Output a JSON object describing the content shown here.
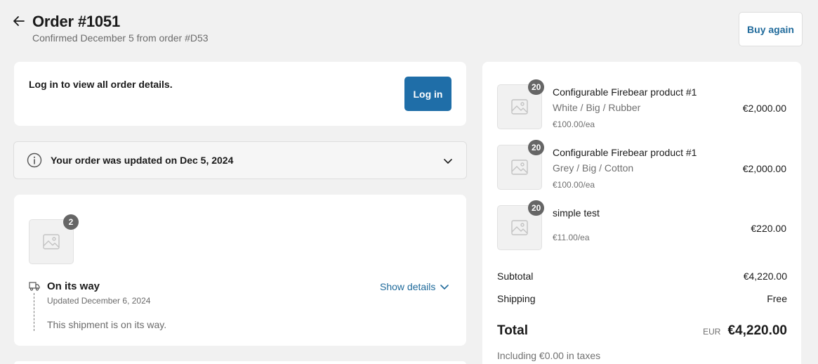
{
  "header": {
    "title": "Order #1051",
    "subtitle": "Confirmed December 5 from order #D53",
    "buy_again_label": "Buy again"
  },
  "login": {
    "text": "Log in to view all order details.",
    "button_label": "Log in"
  },
  "update_notice": {
    "text": "Your order was updated on Dec 5, 2024"
  },
  "shipment": {
    "item_count": "2",
    "status": "On its way",
    "updated": "Updated December 6, 2024",
    "description": "This shipment is on its way.",
    "show_details_label": "Show details"
  },
  "summary": {
    "items": [
      {
        "quantity": "20",
        "name": "Configurable Firebear product #1",
        "variant": "White / Big / Rubber",
        "unit_price": "€100.00/ea",
        "price": "€2,000.00"
      },
      {
        "quantity": "20",
        "name": "Configurable Firebear product #1",
        "variant": "Grey / Big / Cotton",
        "unit_price": "€100.00/ea",
        "price": "€2,000.00"
      },
      {
        "quantity": "20",
        "name": "simple test",
        "unit_price": "€11.00/ea",
        "price": "€220.00"
      }
    ],
    "subtotal_label": "Subtotal",
    "subtotal_value": "€4,220.00",
    "shipping_label": "Shipping",
    "shipping_value": "Free",
    "total_label": "Total",
    "currency": "EUR",
    "total_value": "€4,220.00",
    "taxes_note": "Including €0.00 in taxes"
  },
  "colors": {
    "accent": "#1f6ea8",
    "link": "#1f6a9b",
    "background": "#f1f1f1",
    "badge": "#666666"
  }
}
